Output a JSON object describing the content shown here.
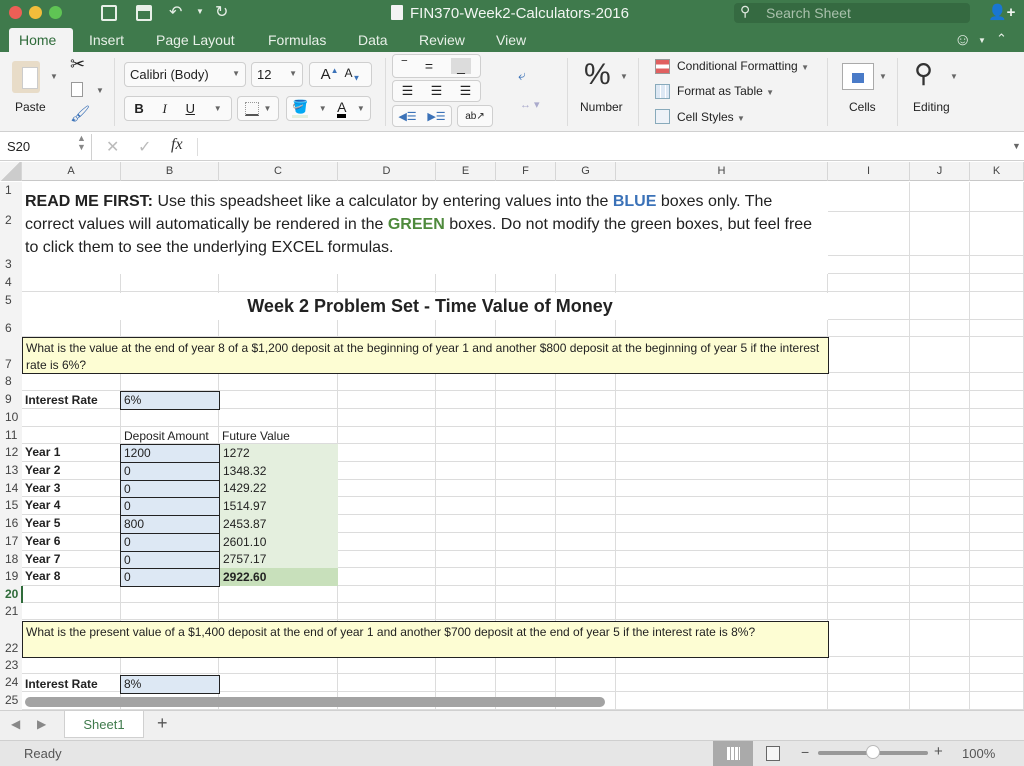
{
  "window": {
    "title": "FIN370-Week2-Calculators-2016",
    "search_placeholder": "Search Sheet"
  },
  "ribbon_tabs": [
    "Home",
    "Insert",
    "Page Layout",
    "Formulas",
    "Data",
    "Review",
    "View"
  ],
  "ribbon": {
    "paste_label": "Paste",
    "font_name": "Calibri (Body)",
    "font_size": "12",
    "bold": "B",
    "italic": "I",
    "underline": "U",
    "number_symbol": "%",
    "number_label": "Number",
    "conditional_formatting": "Conditional Formatting",
    "format_as_table": "Format as Table",
    "cell_styles": "Cell Styles",
    "cells_label": "Cells",
    "editing_label": "Editing"
  },
  "formula_bar": {
    "name_box": "S20",
    "fx": "fx",
    "formula": ""
  },
  "columns": [
    "A",
    "B",
    "C",
    "D",
    "E",
    "F",
    "G",
    "H",
    "I",
    "J",
    "K"
  ],
  "rows": [
    "1",
    "2",
    "3",
    "4",
    "5",
    "6",
    "7",
    "8",
    "9",
    "10",
    "11",
    "12",
    "13",
    "14",
    "15",
    "16",
    "17",
    "18",
    "19",
    "20",
    "21",
    "22",
    "23",
    "24",
    "25"
  ],
  "readme": {
    "bold_prefix": "READ ME FIRST:",
    "text1": " Use this speadsheet like a calculator by entering values into the ",
    "blue_word": "BLUE",
    "text2": " boxes only. The correct values will automatically be rendered in the ",
    "green_word": "GREEN",
    "text3": " boxes. Do not modify the green boxes, but feel free to click them to see the underlying EXCEL formulas."
  },
  "heading": "Week 2 Problem Set - Time Value of Money",
  "problem1": {
    "question": "What is the value at the end of year 8 of a $1,200 deposit at the beginning of year 1 and another $800 deposit at the beginning of year 5 if the interest rate is 6%?",
    "rate_label": "Interest Rate",
    "rate_value": "6%",
    "col_deposit": "Deposit Amount",
    "col_fv": "Future Value",
    "years": [
      {
        "label": "Year 1",
        "deposit": "1200",
        "fv": "1272"
      },
      {
        "label": "Year 2",
        "deposit": "0",
        "fv": "1348.32"
      },
      {
        "label": "Year 3",
        "deposit": "0",
        "fv": "1429.22"
      },
      {
        "label": "Year 4",
        "deposit": "0",
        "fv": "1514.97"
      },
      {
        "label": "Year 5",
        "deposit": "800",
        "fv": "2453.87"
      },
      {
        "label": "Year 6",
        "deposit": "0",
        "fv": "2601.10"
      },
      {
        "label": "Year 7",
        "deposit": "0",
        "fv": "2757.17"
      },
      {
        "label": "Year 8",
        "deposit": "0",
        "fv": "2922.60"
      }
    ]
  },
  "problem2": {
    "question": "What is the present value of a $1,400 deposit at the end of year 1 and another $700 deposit at the end of year 5 if the interest rate is 8%?",
    "rate_label": "Interest Rate",
    "rate_value": "8%"
  },
  "sheet_tabs": [
    "Sheet1"
  ],
  "add_sheet": "+",
  "status": {
    "text": "Ready",
    "zoom": "100%",
    "zoom_level": 1.0
  },
  "colors": {
    "brand": "#3f7a4c",
    "blue_text": "#3b72b8",
    "green_text": "#4e8a3c",
    "input_fill": "#dde8f4",
    "output_fill": "#e4efde",
    "question_fill": "#fdfdd3"
  }
}
